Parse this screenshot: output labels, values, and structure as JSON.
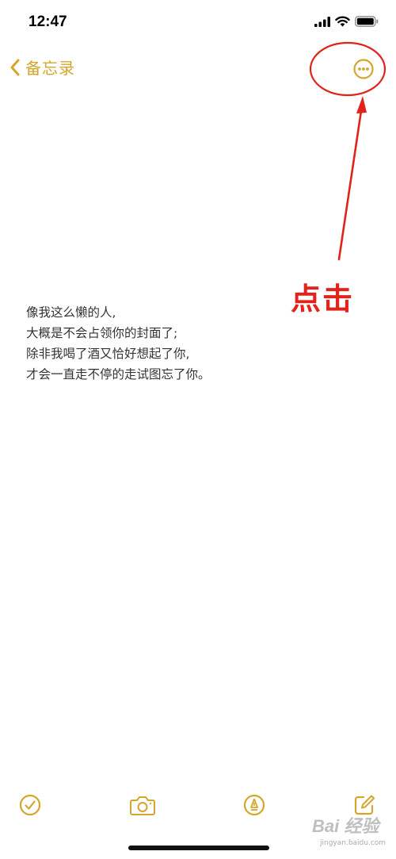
{
  "status_bar": {
    "time": "12:47"
  },
  "nav": {
    "back_label": "备忘录"
  },
  "annotation": {
    "label": "点击",
    "color": "#e2231a"
  },
  "note": {
    "lines": [
      "像我这么懒的人,",
      "大概是不会占领你的封面了;",
      "除非我喝了酒又恰好想起了你,",
      "才会一直走不停的走试图忘了你。"
    ]
  },
  "toolbar": {
    "items": [
      "checklist-icon",
      "camera-icon",
      "markup-icon",
      "compose-icon"
    ]
  },
  "watermark": {
    "text": "Bai 经验",
    "sub": "jingyan.baidu.com"
  },
  "colors": {
    "accent": "#d4a62a",
    "text": "#333333"
  }
}
